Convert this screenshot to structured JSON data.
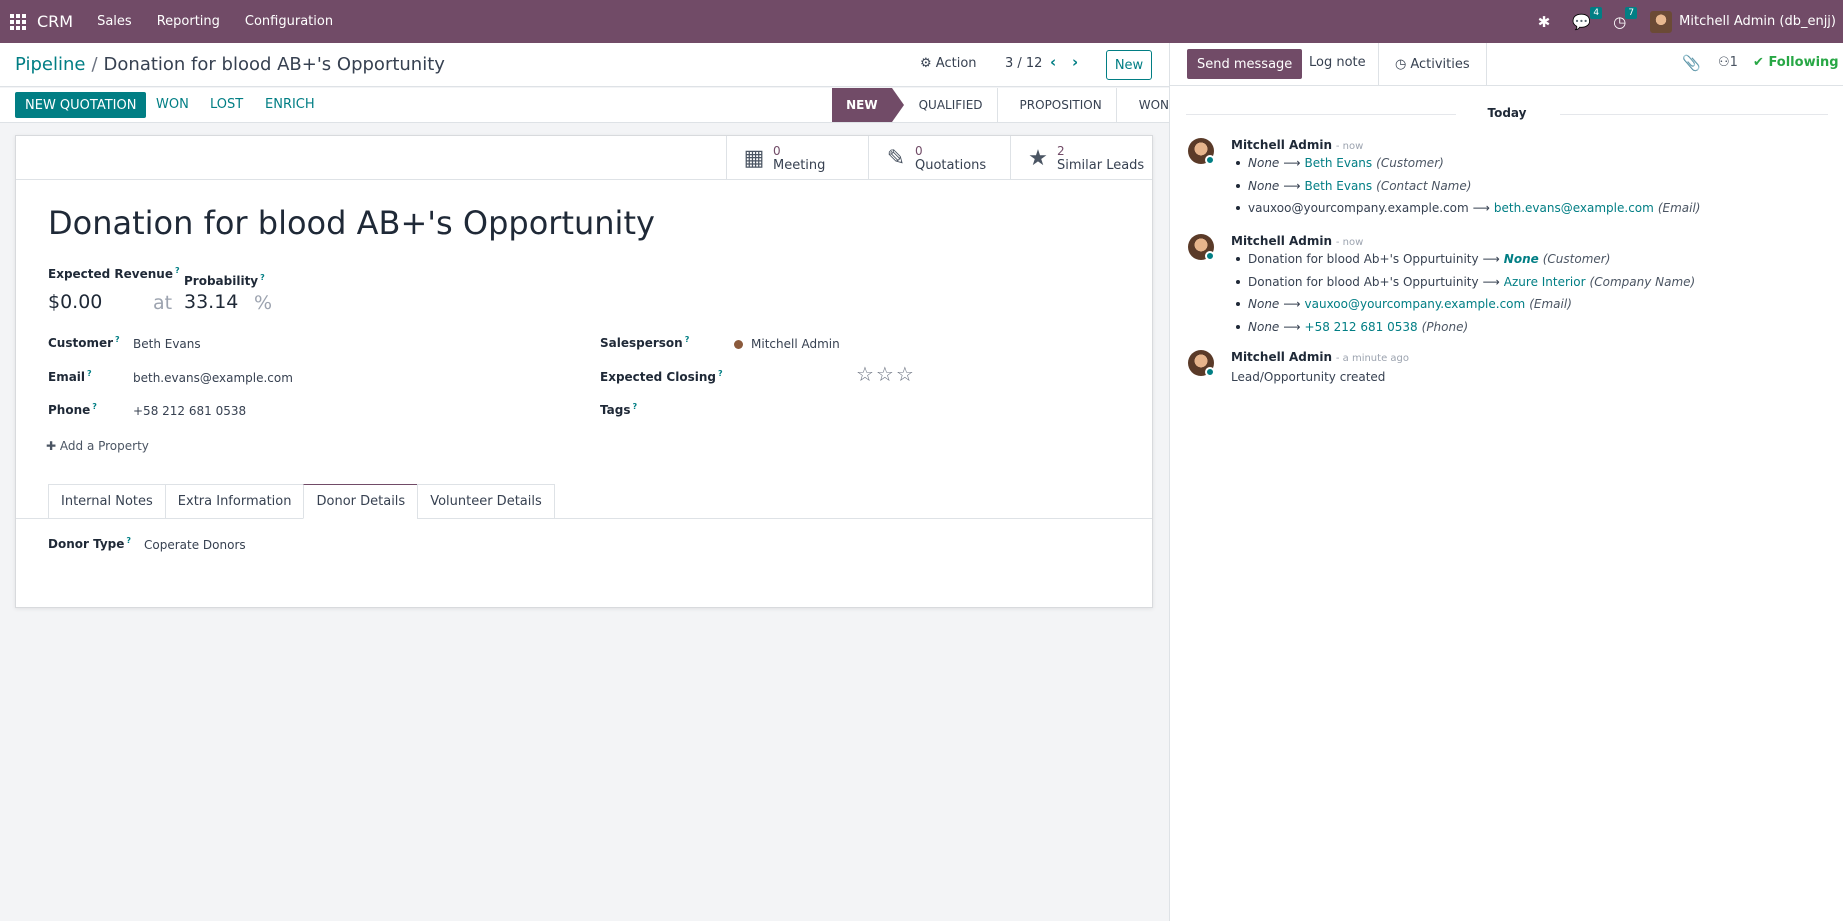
{
  "navbar": {
    "app": "CRM",
    "menu": [
      "Sales",
      "Reporting",
      "Configuration"
    ],
    "messages_count": "4",
    "activities_count": "7",
    "user": "Mitchell Admin (db_enjj)"
  },
  "control": {
    "breadcrumb_root": "Pipeline",
    "breadcrumb_current": "Donation for blood AB+'s Opportunity",
    "action": "Action",
    "pager": "3 / 12",
    "new": "New"
  },
  "statusbar": {
    "new_quotation": "NEW QUOTATION",
    "won": "WON",
    "lost": "LOST",
    "enrich": "ENRICH",
    "stages": [
      "NEW",
      "QUALIFIED",
      "PROPOSITION",
      "WON"
    ],
    "active_stage": "NEW"
  },
  "smart_buttons": [
    {
      "count": "0",
      "label": "Meeting",
      "icon": "calendar-icon"
    },
    {
      "count": "0",
      "label": "Quotations",
      "icon": "edit-icon"
    },
    {
      "count": "2",
      "label": "Similar Leads",
      "icon": "star-icon"
    }
  ],
  "form": {
    "title": "Donation for blood AB+'s Opportunity",
    "expected_revenue_label": "Expected Revenue",
    "expected_revenue": "$0.00",
    "at": "at",
    "probability_label": "Probability",
    "probability": "33.14",
    "percent": "%",
    "customer_label": "Customer",
    "customer": "Beth Evans",
    "email_label": "Email",
    "email": "beth.evans@example.com",
    "phone_label": "Phone",
    "phone": "+58 212 681 0538",
    "salesperson_label": "Salesperson",
    "salesperson": "Mitchell Admin",
    "expected_closing_label": "Expected Closing",
    "priority_stars": "☆☆☆",
    "tags_label": "Tags",
    "add_property": "Add a Property",
    "tabs": [
      "Internal Notes",
      "Extra Information",
      "Donor Details",
      "Volunteer Details"
    ],
    "active_tab": "Donor Details",
    "donor_type_label": "Donor Type",
    "donor_type": "Coperate Donors"
  },
  "chatter": {
    "send_message": "Send message",
    "log_note": "Log note",
    "activities": "Activities",
    "followers_count": "1",
    "following": "Following",
    "today": "Today",
    "messages": [
      {
        "author": "Mitchell Admin",
        "time": "- now",
        "changes": [
          {
            "old": "None",
            "new": "Beth Evans",
            "field": "(Customer)"
          },
          {
            "old": "None",
            "new": "Beth Evans",
            "field": "(Contact Name)"
          },
          {
            "old": "vauxoo@yourcompany.example.com",
            "new": "beth.evans@example.com",
            "field": "(Email)"
          }
        ]
      },
      {
        "author": "Mitchell Admin",
        "time": "- now",
        "changes": [
          {
            "old": "Donation for blood Ab+'s Oppurtuinity",
            "new": "None",
            "field": "(Customer)"
          },
          {
            "old": "Donation for blood Ab+'s Oppurtuinity",
            "new": "Azure Interior",
            "field": "(Company Name)"
          },
          {
            "old": "None",
            "new": "vauxoo@yourcompany.example.com",
            "field": "(Email)"
          },
          {
            "old": "None",
            "new": "+58 212 681 0538",
            "field": "(Phone)"
          }
        ]
      },
      {
        "author": "Mitchell Admin",
        "time": "- a minute ago",
        "body": "Lead/Opportunity created"
      }
    ]
  }
}
